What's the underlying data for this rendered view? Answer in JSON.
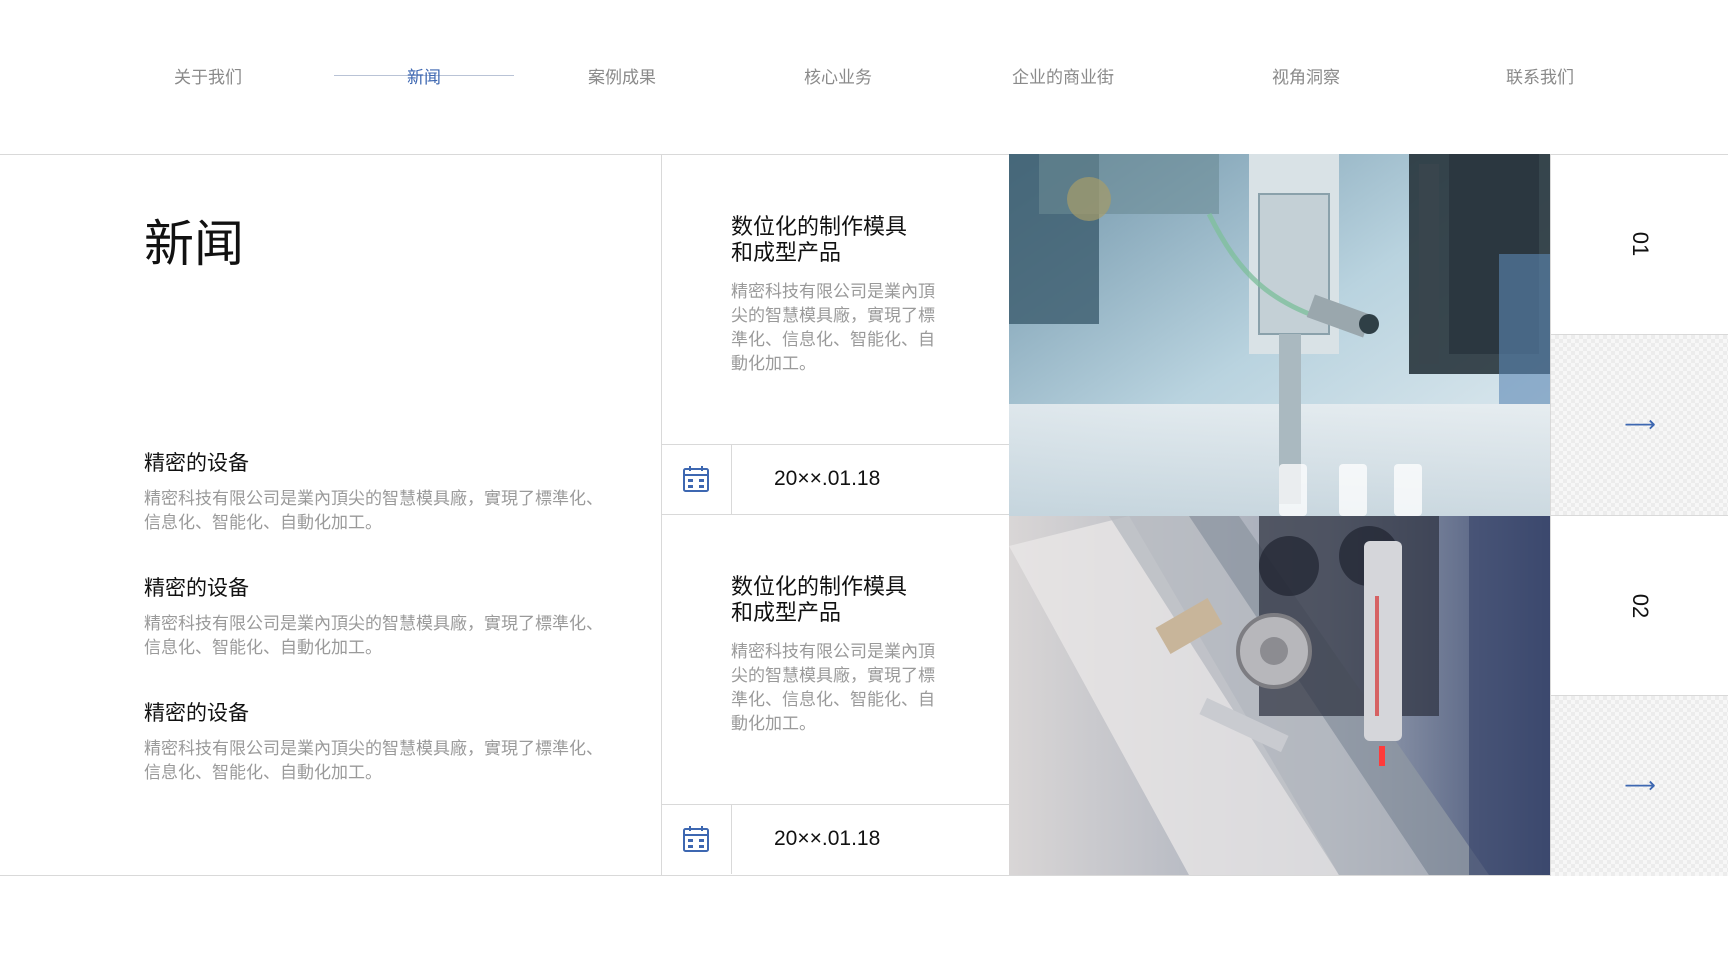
{
  "nav": {
    "items": [
      {
        "label": "关于我们",
        "active": false
      },
      {
        "label": "新闻",
        "active": true
      },
      {
        "label": "案例成果",
        "active": false
      },
      {
        "label": "核心业务",
        "active": false
      },
      {
        "label": "企业的商业街",
        "active": false
      },
      {
        "label": "视角洞察",
        "active": false
      },
      {
        "label": "联系我们",
        "active": false
      }
    ]
  },
  "page_title": "新闻",
  "features": [
    {
      "title": "精密的设备",
      "desc": "精密科技有限公司是業內頂尖的智慧模具廠，實現了標準化、信息化、智能化、自動化加工。"
    },
    {
      "title": "精密的设备",
      "desc": "精密科技有限公司是業內頂尖的智慧模具廠，實現了標準化、信息化、智能化、自動化加工。"
    },
    {
      "title": "精密的设备",
      "desc": "精密科技有限公司是業內頂尖的智慧模具廠，實現了標準化、信息化、智能化、自動化加工。"
    }
  ],
  "news": [
    {
      "title_line1": "数位化的制作模具",
      "title_line2": "和成型产品",
      "desc": "精密科技有限公司是業內頂尖的智慧模具廠，實現了標準化、信息化、智能化、自動化加工。",
      "date": "20××.01.18",
      "number": "01",
      "photo": "factory-robot-arm-photo"
    },
    {
      "title_line1": "数位化的制作模具",
      "title_line2": "和成型产品",
      "desc": "精密科技有限公司是業內頂尖的智慧模具廠，實現了標準化、信息化、智能化、自動化加工。",
      "date": "20××.01.18",
      "number": "02",
      "photo": "factory-test-tube-machine-photo"
    }
  ],
  "icons": {
    "date": "calendar-icon",
    "arrow": "arrow-right-icon"
  },
  "colors": {
    "accent": "#3d67b1",
    "muted_text": "#9a9a9a",
    "divider": "#d9d9d9"
  }
}
